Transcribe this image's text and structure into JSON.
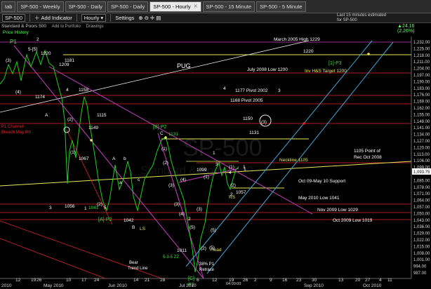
{
  "tabs": [
    "SP-500 - Weekly",
    "SP-500 - Daily",
    "SP-500 - Daily",
    "SP-500 - Hourly",
    "SP-500 - 15 Minute",
    "SP-500 - 5 Minute"
  ],
  "tab_left": "tab",
  "toolbar": {
    "symbol": "SP-500",
    "add_indicator": "Add Indicator",
    "interval": "Hourly",
    "settings": "Settings"
  },
  "sub1": {
    "name": "Standard & Poors 500",
    "add_portfolio": "Add to Portfolio",
    "drawings": "Drawings"
  },
  "sub2": "Price History",
  "delay": [
    "Last 15 minutes estimated",
    "for SP-500"
  ],
  "change": "24.16 (2.26%)",
  "watermark": [
    "SP-500",
    "Standard & Poor's 500"
  ],
  "price_axis": [
    "1,232.00",
    "1,225.00",
    "1,218.00",
    "1,211.00",
    "1,204.00",
    "1,197.00",
    "1,190.00",
    "1,183.00",
    "1,176.00",
    "1,169.00",
    "1,162.00",
    "1,155.00",
    "1,148.00",
    "1,141.00",
    "1,134.00",
    "1,127.00",
    "1,120.00",
    "1,113.00",
    "1,106.00",
    "1,099.00",
    "1,093.75",
    "1,085.00",
    "1,078.00",
    "1,071.00",
    "1,064.00",
    "1,057.00",
    "1,050.00",
    "1,043.00",
    "1,036.00",
    "1,029.00",
    "1,022.00",
    "1,015.00",
    "1,008.00",
    "1,001.00",
    "994.00",
    "987.00"
  ],
  "date_axis": [
    "2010",
    "12",
    "19",
    "26",
    "May 2010",
    "10",
    "17",
    "24",
    "Jun 2010",
    "14",
    "21",
    "28",
    "Jul 2010",
    "6",
    "12",
    "19",
    "26",
    "2",
    "9",
    "16",
    "23",
    "30",
    "Sep 2010",
    "13",
    "20",
    "27",
    "4",
    "Oct 2010",
    "11"
  ],
  "time_label": "04:00:00",
  "levels": [
    "March 2005 High 1229",
    "1220",
    "July 2008 Low 1200",
    "1177 Pivot 2002",
    "1168 Pivot 2005",
    "1150",
    "1131",
    "Neckline 1105",
    "Oct 09-May 10 Support",
    "May 2010 Low 1041",
    "Nov 2009 Low 1029",
    "Oct 2009 Low 1019",
    "1105 Point of",
    "Rec Oct 2008"
  ],
  "labels": {
    "pug": "PUG",
    "p1": "P1",
    "p2": "P2",
    "inv": "[1]-P3",
    "inv2": "Inv H&S Target 1200",
    "ap2": "[A]-P2",
    "bp2": "[B]-P2",
    "cp2": "[C]",
    "channel1": "P1 Channel",
    "channel2": "Breach May 6th",
    "bear1": "Bear",
    "bear2": "Trend Line",
    "retr1": "38% P1",
    "retr2": "Retrace",
    "head": "Head",
    "rs": "RS",
    "ls": "LS",
    "zz": "5-3-5 ZZ",
    "waves": [
      "(3)",
      "(4)",
      "5-[5]",
      "1220",
      "2",
      "1209",
      "1181",
      "1174",
      "4",
      "1158",
      "A",
      "(2)",
      "1149",
      "1115",
      "(1)",
      "1067",
      "3",
      "1056",
      "1",
      "(2)",
      "5",
      "1041",
      "1042",
      "A",
      "b",
      "B",
      "a",
      "c",
      "C",
      "1131",
      "(4)",
      "(3)",
      "(2)",
      "(1)",
      "(3)",
      "(4)",
      "(5)",
      "2",
      "1099",
      "1",
      "3",
      "(1)",
      "4",
      "(2)",
      "2",
      "1057",
      "(1)",
      "1011",
      "(2)",
      "(5)",
      "(3)",
      "4",
      "3",
      "1",
      "(3)",
      "(5)",
      "1"
    ]
  },
  "colors": {
    "bg": "#000000",
    "price": "#1fd11f",
    "red": "#e0262c",
    "magenta": "#c83fc3",
    "yellow": "#e8e85c",
    "cyan": "#3fa9d8",
    "white": "#ffffff",
    "green": "#3fdc3f"
  }
}
